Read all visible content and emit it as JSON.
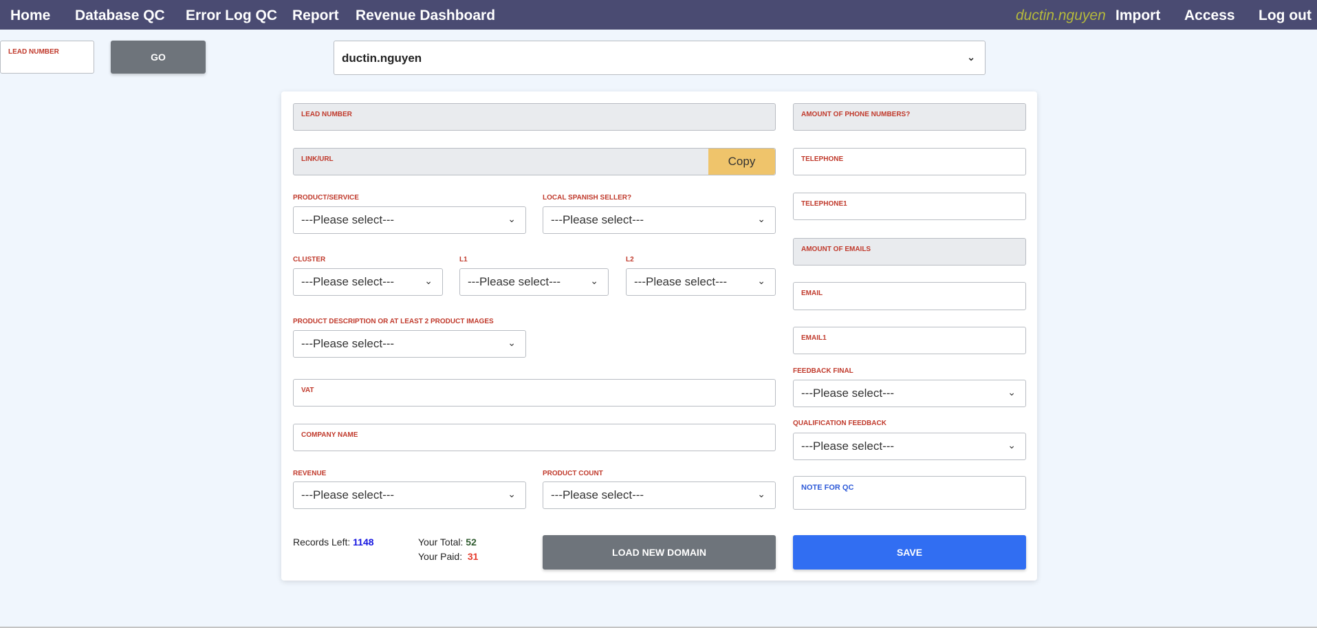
{
  "nav": {
    "home": "Home",
    "database_qc": "Database QC",
    "error_log_qc": "Error Log QC",
    "report": "Report",
    "revenue_dashboard": "Revenue Dashboard",
    "user": "ductin.nguyen",
    "import": "Import",
    "access": "Access",
    "logout": "Log out"
  },
  "top": {
    "lead_label": "LEAD NUMBER",
    "go": "GO",
    "user_select": "ductin.nguyen"
  },
  "form": {
    "lead_number": "LEAD NUMBER",
    "link_url": "LINK/URL",
    "copy": "Copy",
    "product_service": "PRODUCT/SERVICE",
    "local_spanish_seller": "LOCAL SPANISH SELLER?",
    "cluster": "CLUSTER",
    "l1": "L1",
    "l2": "L2",
    "product_description": "PRODUCT DESCRIPTION OR AT LEAST 2 PRODUCT IMAGES",
    "vat": "VAT",
    "company_name": "COMPANY NAME",
    "revenue": "REVENUE",
    "product_count": "PRODUCT COUNT",
    "amount_phone": "AMOUNT OF PHONE NUMBERS?",
    "telephone": "TELEPHONE",
    "telephone1": "TELEPHONE1",
    "amount_emails": "AMOUNT OF EMAILS",
    "email": "EMAIL",
    "email1": "EMAIL1",
    "feedback_final": "FEEDBACK FINAL",
    "qualification_feedback": "QUALIFICATION FEEDBACK",
    "note_for_qc": "NOTE FOR QC",
    "placeholder": "---Please select---"
  },
  "stats": {
    "records_left_label": "Records Left:",
    "records_left": "1148",
    "total_label": "Your Total:",
    "total": "52",
    "paid_label": "Your Paid:",
    "paid": "31"
  },
  "buttons": {
    "load_new_domain": "LOAD NEW DOMAIN",
    "save": "SAVE"
  },
  "colors": {
    "nav": "#4a4b72",
    "save": "#316ef2",
    "gray_btn": "#6e747b",
    "copy": "#efc46b",
    "label": "#c0392b"
  }
}
